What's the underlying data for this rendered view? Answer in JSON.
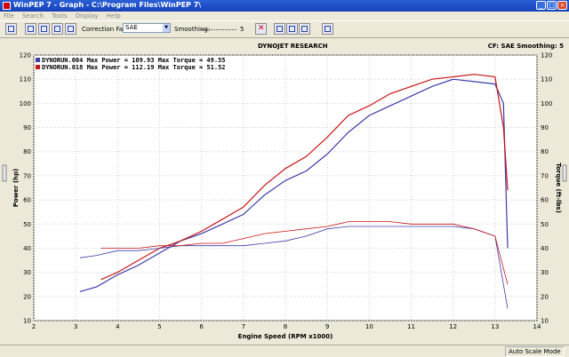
{
  "window": {
    "title": "WinPEP 7 - Graph - C:\\Program Files\\WinPEP 7\\",
    "minimize_icon": "minimize-icon",
    "maximize_icon": "maximize-icon",
    "close_icon": "close-icon"
  },
  "menu": [
    "File",
    "Search",
    "Tools",
    "Display",
    "Help"
  ],
  "toolbar": {
    "correction_factor_label": "Correction Factor",
    "correction_factor_value": "SAE",
    "smoothing_label": "Smoothing:",
    "smoothing_value": "5"
  },
  "header": {
    "center": "DYNOJET RESEARCH",
    "right": "CF: SAE  Smoothing: 5"
  },
  "status": {
    "mode": "Auto Scale Mode"
  },
  "colors": {
    "run1": "#3c3ca8",
    "run2": "#c81414"
  },
  "chart_data": {
    "type": "line",
    "xlabel": "Engine Speed (RPM x1000)",
    "ylabel_left": "Power (hp)",
    "ylabel_right": "Torque (ft-lbs)",
    "xlim": [
      2,
      14
    ],
    "ylim_left": [
      10,
      120
    ],
    "ylim_right": [
      10,
      120
    ],
    "x_ticks": [
      "2",
      "3",
      "4",
      "5",
      "6",
      "7",
      "8",
      "9",
      "10",
      "11",
      "12",
      "13",
      "14"
    ],
    "y_ticks": [
      "10",
      "20",
      "30",
      "40",
      "50",
      "60",
      "70",
      "80",
      "90",
      "100",
      "110",
      "120"
    ],
    "grid": true,
    "legend": [
      {
        "name": "DYNORUN.004 Max Power = 109.93 Max Torque = 49.55",
        "color": "#3c3ca8"
      },
      {
        "name": "DYNORUN.018 Max Power = 112.19 Max Torque = 51.52",
        "color": "#c81414"
      }
    ],
    "series": [
      {
        "name": "DYNORUN.004",
        "measure": "power",
        "color": "#3c3ca8",
        "x": [
          3.1,
          3.5,
          4.0,
          4.5,
          5.0,
          5.5,
          6.0,
          6.5,
          7.0,
          7.5,
          8.0,
          8.5,
          9.0,
          9.5,
          10.0,
          10.5,
          11.0,
          11.5,
          12.0,
          12.5,
          13.0,
          13.2,
          13.3
        ],
        "y": [
          22,
          24,
          29,
          33,
          38,
          43,
          46,
          50,
          54,
          62,
          68,
          72,
          79,
          88,
          95,
          99,
          103,
          107,
          110,
          109,
          108,
          100,
          40
        ]
      },
      {
        "name": "DYNORUN.018",
        "measure": "power",
        "color": "#c81414",
        "x": [
          3.6,
          4.0,
          4.5,
          5.0,
          5.5,
          6.0,
          6.5,
          7.0,
          7.5,
          8.0,
          8.5,
          9.0,
          9.5,
          10.0,
          10.5,
          11.0,
          11.5,
          12.0,
          12.5,
          13.0,
          13.2,
          13.3
        ],
        "y": [
          27,
          30,
          35,
          40,
          43,
          47,
          52,
          57,
          66,
          73,
          78,
          86,
          95,
          99,
          104,
          107,
          110,
          111,
          112,
          111,
          90,
          64
        ]
      },
      {
        "name": "DYNORUN.004",
        "measure": "torque",
        "color": "#3c3ca8",
        "x": [
          3.1,
          3.5,
          4.0,
          4.5,
          5.0,
          5.5,
          6.0,
          6.5,
          7.0,
          7.5,
          8.0,
          8.5,
          9.0,
          9.5,
          10.0,
          10.5,
          11.0,
          11.5,
          12.0,
          12.5,
          13.0,
          13.3
        ],
        "y": [
          36,
          37,
          39,
          39,
          40,
          41,
          41,
          41,
          41,
          42,
          43,
          45,
          48,
          49,
          49,
          49,
          49,
          49,
          49,
          48,
          45,
          15
        ]
      },
      {
        "name": "DYNORUN.018",
        "measure": "torque",
        "color": "#c81414",
        "x": [
          3.6,
          4.0,
          4.5,
          5.0,
          5.5,
          6.0,
          6.5,
          7.0,
          7.5,
          8.0,
          8.5,
          9.0,
          9.5,
          10.0,
          10.5,
          11.0,
          11.5,
          12.0,
          12.5,
          13.0,
          13.3
        ],
        "y": [
          40,
          40,
          40,
          41,
          41,
          42,
          42,
          44,
          46,
          47,
          48,
          49,
          51,
          51,
          51,
          50,
          50,
          50,
          48,
          45,
          25
        ]
      }
    ]
  }
}
